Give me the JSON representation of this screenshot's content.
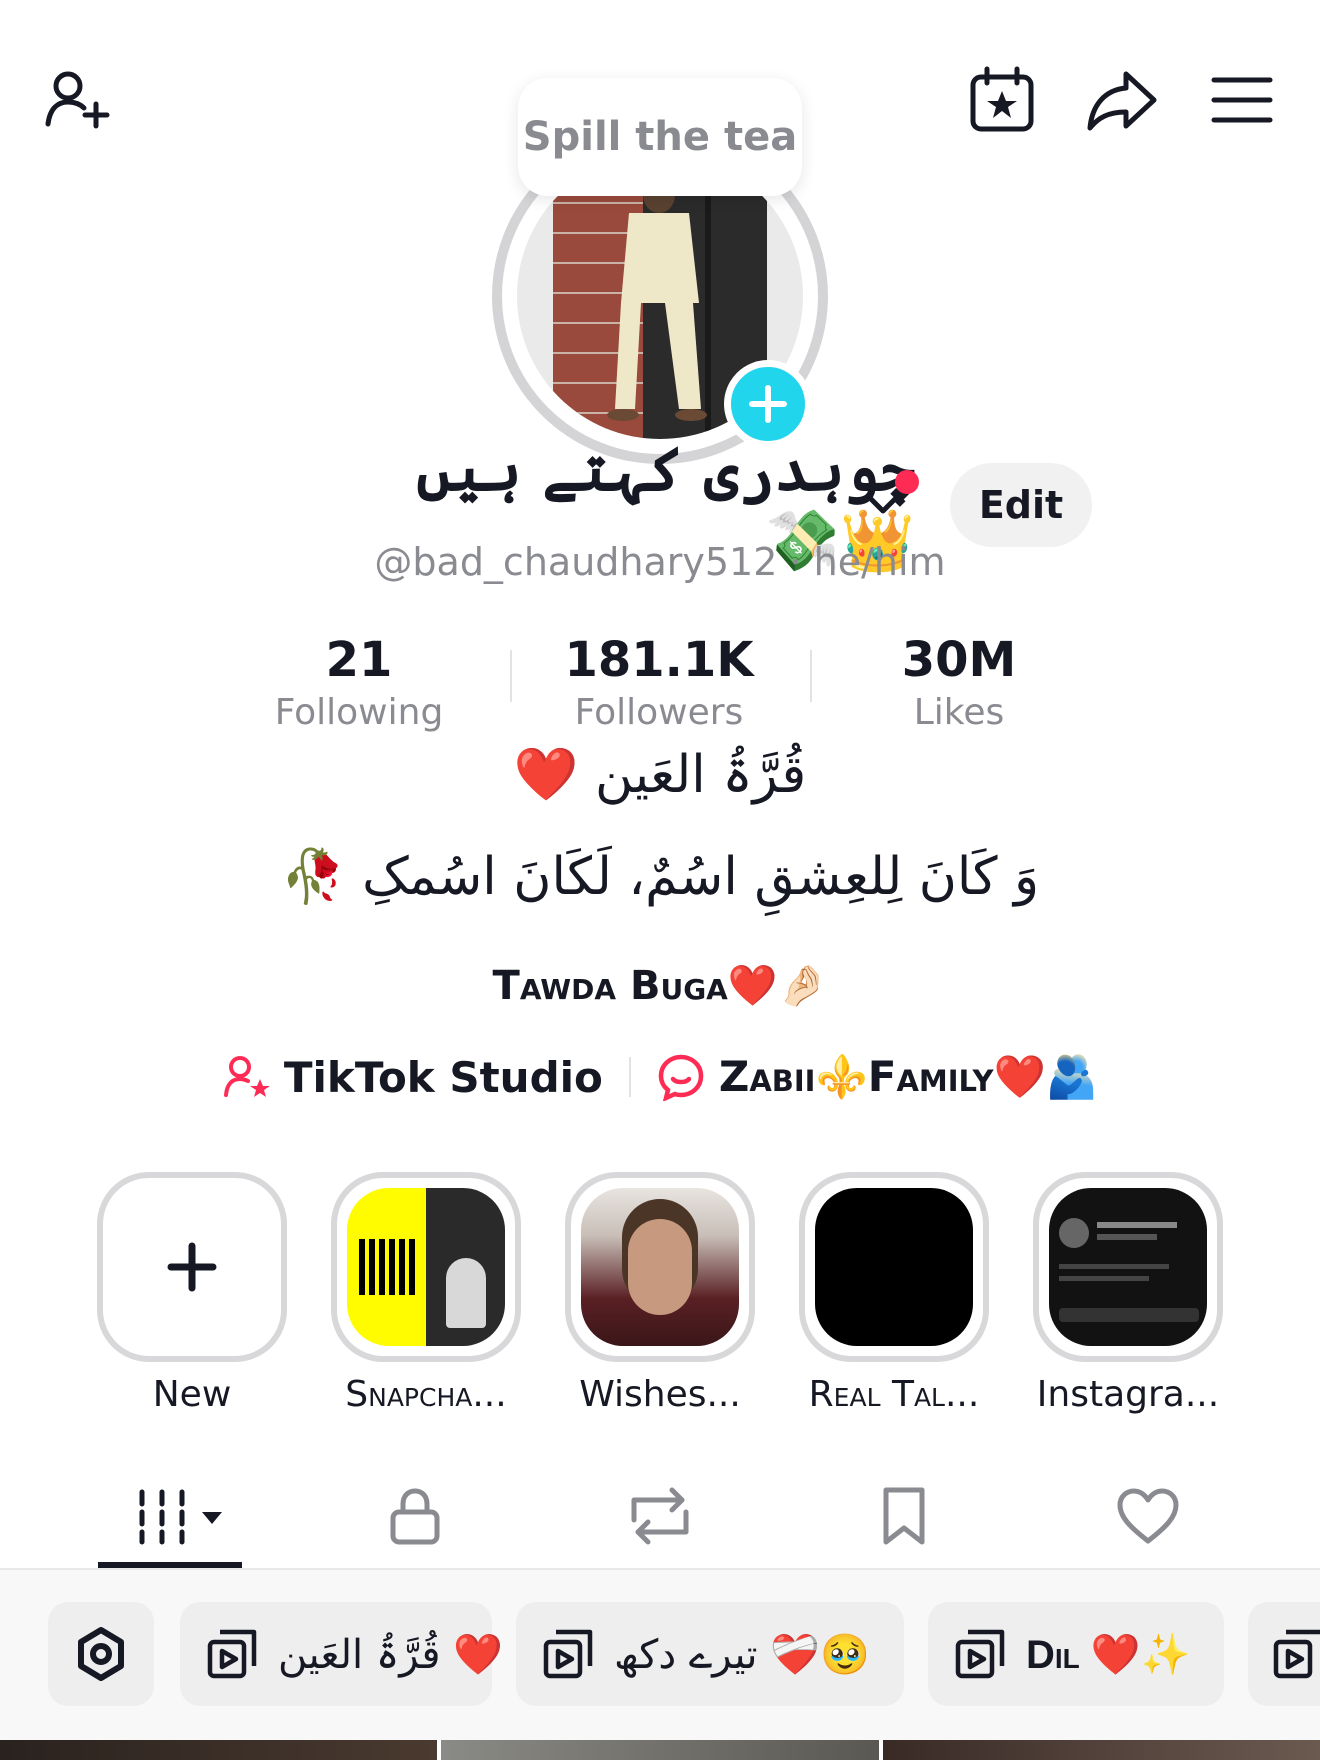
{
  "tooltip": {
    "text": "Spill the tea"
  },
  "profile": {
    "display_name": "چوہدری کہتے ہیں 👑💸",
    "edit_label": "Edit",
    "handle_line": "@bad_chaudhary512 · he/him"
  },
  "stats": [
    {
      "value": "21",
      "label": "Following"
    },
    {
      "value": "181.1K",
      "label": "Followers"
    },
    {
      "value": "30M",
      "label": "Likes"
    }
  ],
  "bio": {
    "line1": "قُرَّۃُ العَین ❤️",
    "line2": "وَ کَانَ لِلعِشقِ اسُمٌ، لَکَانَ اسُمکِ 🥀",
    "line3": "Tawda Buga❤️🤌🏻"
  },
  "links": {
    "studio_label": "TikTok Studio",
    "family_label": "Zabii⚜️Family❤️🫂"
  },
  "highlights": [
    {
      "label": "New"
    },
    {
      "label": "Snapcha..."
    },
    {
      "label": "Wishes..."
    },
    {
      "label": "Real Tal..."
    },
    {
      "label": "Instagra..."
    }
  ],
  "tabs": [
    "videos-grid-icon",
    "lock-icon",
    "repost-icon",
    "bookmark-icon",
    "heart-icon"
  ],
  "playlists": [
    {
      "title": "قُرَّۃُ العَین ❤️"
    },
    {
      "title": "تیرے دکھ ❤️‍🩹🥹"
    },
    {
      "title": "Dil ❤️✨"
    }
  ],
  "colors": {
    "accent_red": "#fe2c55",
    "plus_cyan": "#20d5ec",
    "muted_text": "#8a8b91"
  }
}
